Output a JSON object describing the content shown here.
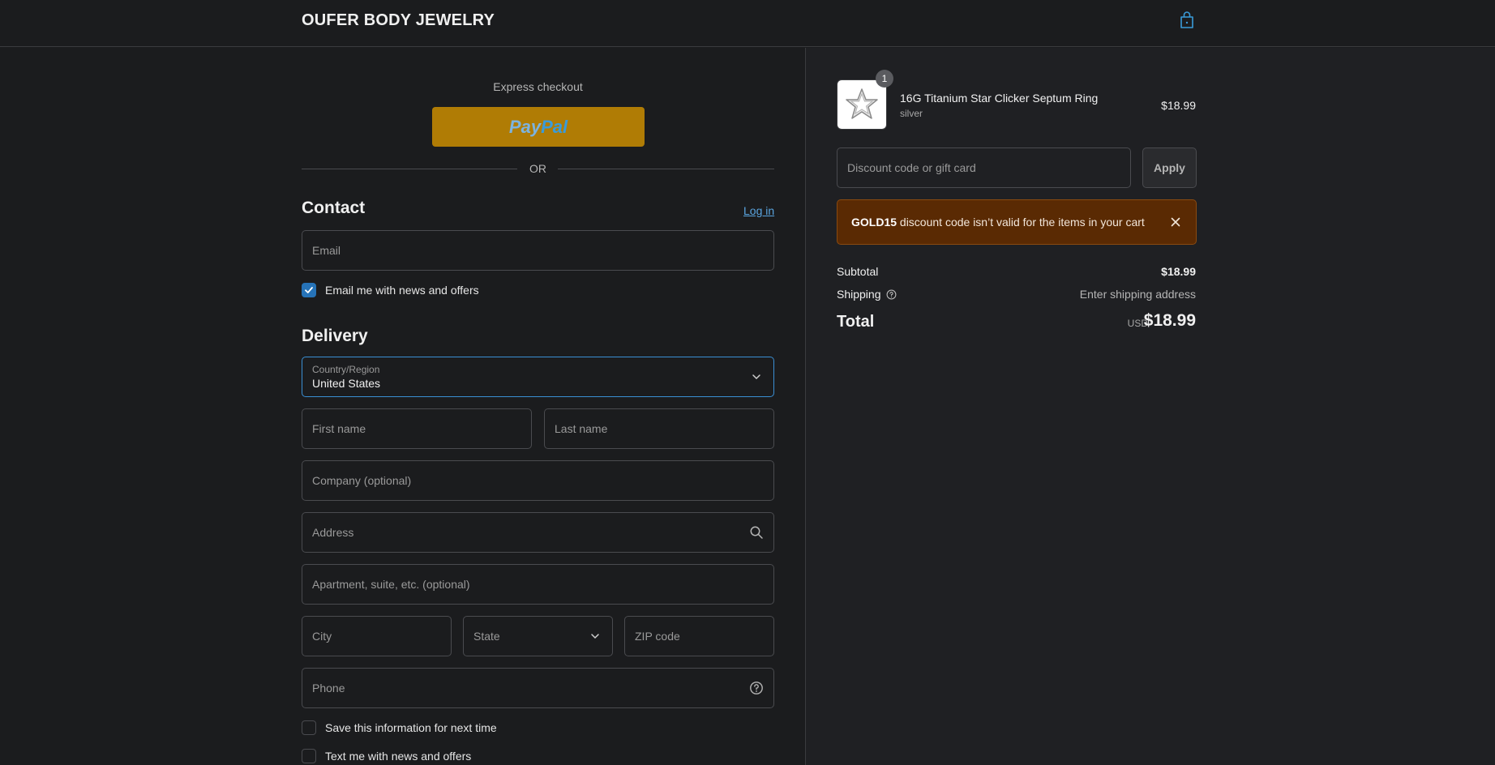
{
  "header": {
    "brand": "OUFER BODY JEWELRY"
  },
  "express": {
    "title": "Express checkout",
    "paypal_a": "Pay",
    "paypal_b": "Pal",
    "or": "OR"
  },
  "contact": {
    "title": "Contact",
    "login": "Log in",
    "email_placeholder": "Email",
    "news_label": "Email me with news and offers",
    "news_checked": true
  },
  "delivery": {
    "title": "Delivery",
    "country_label": "Country/Region",
    "country_value": "United States",
    "first_name": "First name",
    "last_name": "Last name",
    "company": "Company (optional)",
    "address": "Address",
    "apartment": "Apartment, suite, etc. (optional)",
    "city": "City",
    "state": "State",
    "zip": "ZIP code",
    "phone": "Phone",
    "save_info": "Save this information for next time",
    "text_me": "Text me with news and offers"
  },
  "cart": {
    "item": {
      "name": "16G Titanium Star Clicker Septum Ring",
      "variant": "silver",
      "price": "$18.99",
      "qty": "1"
    },
    "discount_placeholder": "Discount code or gift card",
    "apply": "Apply",
    "error_code": "GOLD15",
    "error_text": " discount code isn’t valid for the items in your cart",
    "subtotal_label": "Subtotal",
    "subtotal_value": "$18.99",
    "shipping_label": "Shipping",
    "shipping_value": "Enter shipping address",
    "total_label": "Total",
    "currency": "USD",
    "total_value": "$18.99"
  },
  "colors": {
    "accent": "#2673b8",
    "paypal": "#b07c05",
    "error_bg": "#5a2a03"
  }
}
